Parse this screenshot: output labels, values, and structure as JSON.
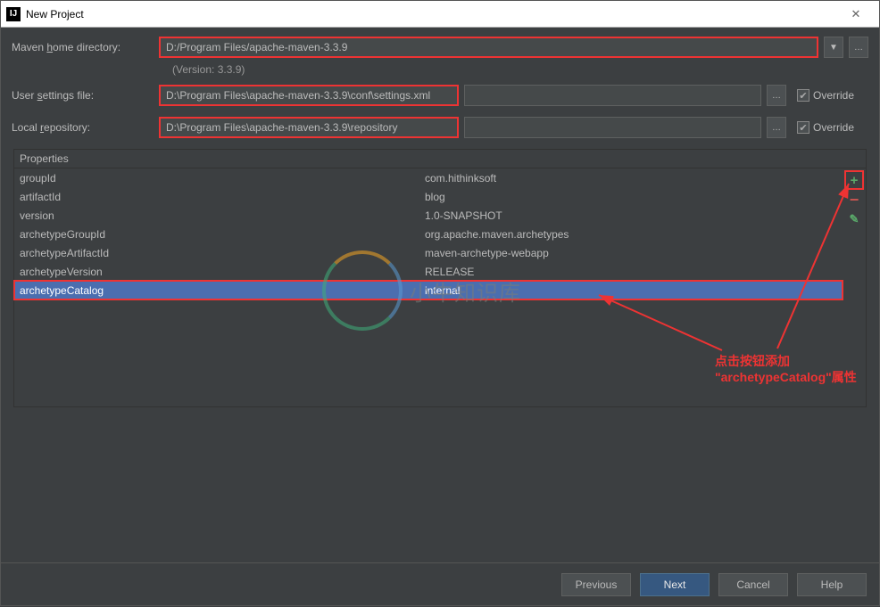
{
  "window": {
    "title": "New Project"
  },
  "form": {
    "maven_home_label": "Maven home directory:",
    "maven_home_value": "D:/Program Files/apache-maven-3.3.9",
    "version_text": "(Version: 3.3.9)",
    "user_settings_label": "User settings file:",
    "user_settings_value": "D:\\Program Files\\apache-maven-3.3.9\\conf\\settings.xml",
    "local_repo_label": "Local repository:",
    "local_repo_value": "D:\\Program Files\\apache-maven-3.3.9\\repository",
    "override_label": "Override"
  },
  "properties": {
    "header": "Properties",
    "rows": [
      {
        "key": "groupId",
        "value": "com.hithinksoft"
      },
      {
        "key": "artifactId",
        "value": "blog"
      },
      {
        "key": "version",
        "value": "1.0-SNAPSHOT"
      },
      {
        "key": "archetypeGroupId",
        "value": "org.apache.maven.archetypes"
      },
      {
        "key": "archetypeArtifactId",
        "value": "maven-archetype-webapp"
      },
      {
        "key": "archetypeVersion",
        "value": "RELEASE"
      },
      {
        "key": "archetypeCatalog",
        "value": "internal"
      }
    ]
  },
  "annotation": {
    "line1": "点击按钮添加",
    "line2": "\"archetypeCatalog\"属性"
  },
  "buttons": {
    "previous": "Previous",
    "next": "Next",
    "cancel": "Cancel",
    "help": "Help"
  },
  "watermark": "小牛知识库"
}
